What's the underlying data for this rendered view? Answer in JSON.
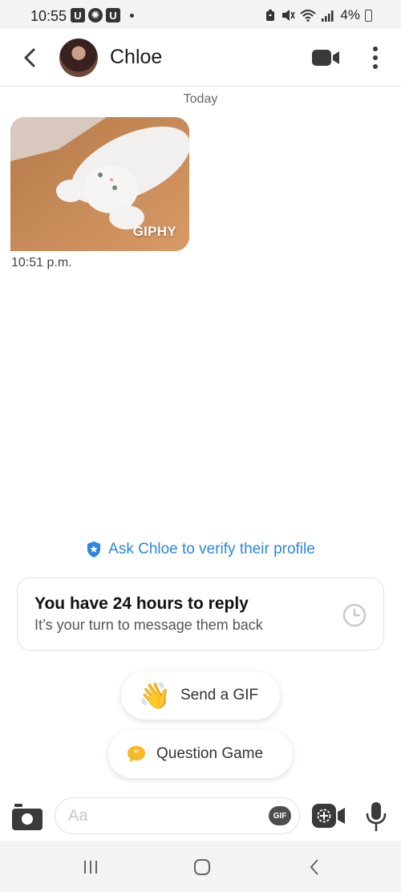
{
  "status_bar": {
    "time": "10:55",
    "battery": "4%",
    "icons": [
      "u-app-icon",
      "basketball-icon",
      "u-app-icon",
      "dot-icon",
      "battery-saver-icon",
      "mute-icon",
      "wifi-icon",
      "signal-icon",
      "battery-charging-icon"
    ]
  },
  "header": {
    "contact_name": "Chloe",
    "back_icon": "chevron-left-icon",
    "video_icon": "video-camera-icon",
    "more_icon": "vertical-dots-icon"
  },
  "conversation": {
    "date_separator": "Today",
    "messages": [
      {
        "type": "gif",
        "badge": "GIPHY",
        "time": "10:51 p.m."
      }
    ]
  },
  "verify": {
    "label": "Ask Chloe to verify their profile",
    "icon": "verified-shield-icon",
    "color": "#2e86de"
  },
  "reply_card": {
    "title": "You have 24 hours to reply",
    "subtitle": "It’s your turn to message them back",
    "icon": "clock-icon"
  },
  "suggestions": [
    {
      "label": "Send a GIF",
      "icon": "waving-hand-icon"
    },
    {
      "label": "Question Game",
      "icon": "speech-bubble-quote-icon"
    }
  ],
  "input_bar": {
    "placeholder": "Aa",
    "gif_label": "GIF",
    "icons": [
      "camera-icon",
      "gif-icon",
      "media-video-icon",
      "microphone-icon"
    ]
  },
  "colors": {
    "accent_blue": "#2e86de",
    "accent_yellow": "#f6b928",
    "icon_dark": "#3a3a3a"
  }
}
